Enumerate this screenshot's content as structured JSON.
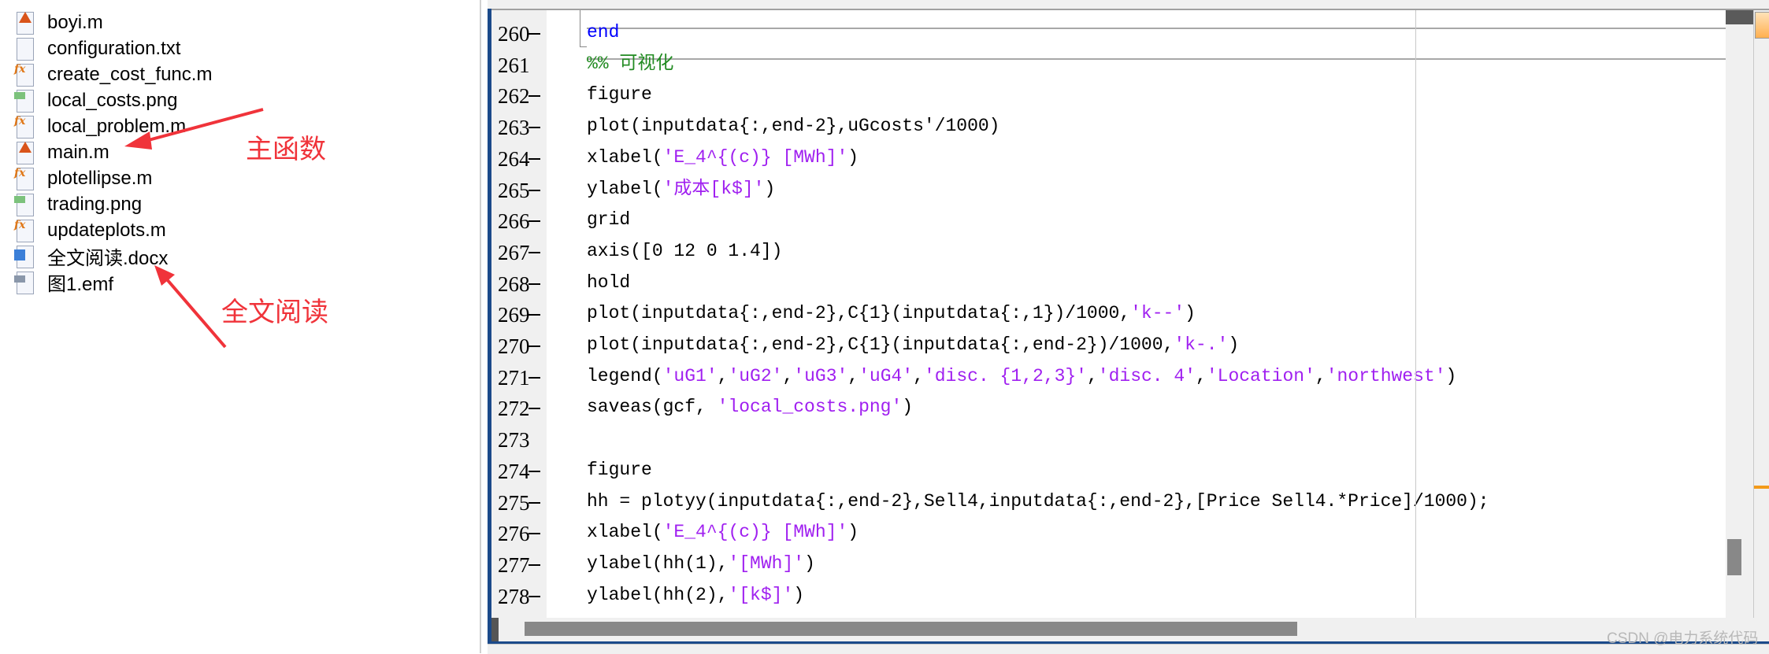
{
  "files": [
    {
      "name": "boyi.m",
      "icon": "matlab-script-icon"
    },
    {
      "name": "configuration.txt",
      "icon": "text-file-icon"
    },
    {
      "name": "create_cost_func.m",
      "icon": "matlab-function-icon"
    },
    {
      "name": "local_costs.png",
      "icon": "image-file-icon"
    },
    {
      "name": "local_problem.m",
      "icon": "matlab-function-icon"
    },
    {
      "name": "main.m",
      "icon": "matlab-script-icon"
    },
    {
      "name": "plotellipse.m",
      "icon": "matlab-function-icon"
    },
    {
      "name": "trading.png",
      "icon": "image-file-icon"
    },
    {
      "name": "updateplots.m",
      "icon": "matlab-function-icon"
    },
    {
      "name": "全文阅读.docx",
      "icon": "word-doc-icon"
    },
    {
      "name": "图1.emf",
      "icon": "emf-file-icon"
    }
  ],
  "annotations": {
    "main": "主函数",
    "fulltext": "全文阅读"
  },
  "colors": {
    "keyword": "#0000ff",
    "string": "#a020f0",
    "comment": "#228b22",
    "text": "#000000",
    "annotation": "#f0333a"
  },
  "code": {
    "lines": [
      {
        "num": "260",
        "dash": true,
        "tokens": [
          {
            "t": "end",
            "c": "keyword"
          }
        ]
      },
      {
        "num": "261",
        "dash": false,
        "tokens": [
          {
            "t": "%% 可视化",
            "c": "comment"
          }
        ]
      },
      {
        "num": "262",
        "dash": true,
        "tokens": [
          {
            "t": "figure",
            "c": "text"
          }
        ]
      },
      {
        "num": "263",
        "dash": true,
        "tokens": [
          {
            "t": "plot(inputdata{:,end-2},uGcosts'/1000)",
            "c": "text"
          }
        ]
      },
      {
        "num": "264",
        "dash": true,
        "tokens": [
          {
            "t": "xlabel(",
            "c": "text"
          },
          {
            "t": "'E_4^{(c)} [MWh]'",
            "c": "string"
          },
          {
            "t": ")",
            "c": "text"
          }
        ]
      },
      {
        "num": "265",
        "dash": true,
        "tokens": [
          {
            "t": "ylabel(",
            "c": "text"
          },
          {
            "t": "'成本[k$]'",
            "c": "string"
          },
          {
            "t": ")",
            "c": "text"
          }
        ]
      },
      {
        "num": "266",
        "dash": true,
        "tokens": [
          {
            "t": "grid",
            "c": "text"
          }
        ]
      },
      {
        "num": "267",
        "dash": true,
        "tokens": [
          {
            "t": "axis([0 12 0 1.4])",
            "c": "text"
          }
        ]
      },
      {
        "num": "268",
        "dash": true,
        "tokens": [
          {
            "t": "hold",
            "c": "text"
          }
        ]
      },
      {
        "num": "269",
        "dash": true,
        "tokens": [
          {
            "t": "plot(inputdata{:,end-2},C{1}(inputdata{:,1})/1000,",
            "c": "text"
          },
          {
            "t": "'k--'",
            "c": "string"
          },
          {
            "t": ")",
            "c": "text"
          }
        ]
      },
      {
        "num": "270",
        "dash": true,
        "tokens": [
          {
            "t": "plot(inputdata{:,end-2},C{1}(inputdata{:,end-2})/1000,",
            "c": "text"
          },
          {
            "t": "'k-.'",
            "c": "string"
          },
          {
            "t": ")",
            "c": "text"
          }
        ]
      },
      {
        "num": "271",
        "dash": true,
        "tokens": [
          {
            "t": "legend(",
            "c": "text"
          },
          {
            "t": "'uG1'",
            "c": "string"
          },
          {
            "t": ",",
            "c": "text"
          },
          {
            "t": "'uG2'",
            "c": "string"
          },
          {
            "t": ",",
            "c": "text"
          },
          {
            "t": "'uG3'",
            "c": "string"
          },
          {
            "t": ",",
            "c": "text"
          },
          {
            "t": "'uG4'",
            "c": "string"
          },
          {
            "t": ",",
            "c": "text"
          },
          {
            "t": "'disc. {1,2,3}'",
            "c": "string"
          },
          {
            "t": ",",
            "c": "text"
          },
          {
            "t": "'disc. 4'",
            "c": "string"
          },
          {
            "t": ",",
            "c": "text"
          },
          {
            "t": "'Location'",
            "c": "string"
          },
          {
            "t": ",",
            "c": "text"
          },
          {
            "t": "'northwest'",
            "c": "string"
          },
          {
            "t": ")",
            "c": "text"
          }
        ]
      },
      {
        "num": "272",
        "dash": true,
        "tokens": [
          {
            "t": "saveas(gcf, ",
            "c": "text"
          },
          {
            "t": "'local_costs.png'",
            "c": "string"
          },
          {
            "t": ")",
            "c": "text"
          }
        ]
      },
      {
        "num": "273",
        "dash": false,
        "tokens": []
      },
      {
        "num": "274",
        "dash": true,
        "tokens": [
          {
            "t": "figure",
            "c": "text"
          }
        ]
      },
      {
        "num": "275",
        "dash": true,
        "tokens": [
          {
            "t": "hh = plotyy(inputdata{:,end-2},Sell4,inputdata{:,end-2},[Price Sell4.*Price]/1000);",
            "c": "text"
          }
        ]
      },
      {
        "num": "276",
        "dash": true,
        "tokens": [
          {
            "t": "xlabel(",
            "c": "text"
          },
          {
            "t": "'E_4^{(c)} [MWh]'",
            "c": "string"
          },
          {
            "t": ")",
            "c": "text"
          }
        ]
      },
      {
        "num": "277",
        "dash": true,
        "tokens": [
          {
            "t": "ylabel(hh(1),",
            "c": "text"
          },
          {
            "t": "'[MWh]'",
            "c": "string"
          },
          {
            "t": ")",
            "c": "text"
          }
        ]
      },
      {
        "num": "278",
        "dash": true,
        "tokens": [
          {
            "t": "ylabel(hh(2),",
            "c": "text"
          },
          {
            "t": "'[k$]'",
            "c": "string"
          },
          {
            "t": ")",
            "c": "text"
          }
        ]
      }
    ]
  },
  "watermark": "CSDN @电力系统代码"
}
